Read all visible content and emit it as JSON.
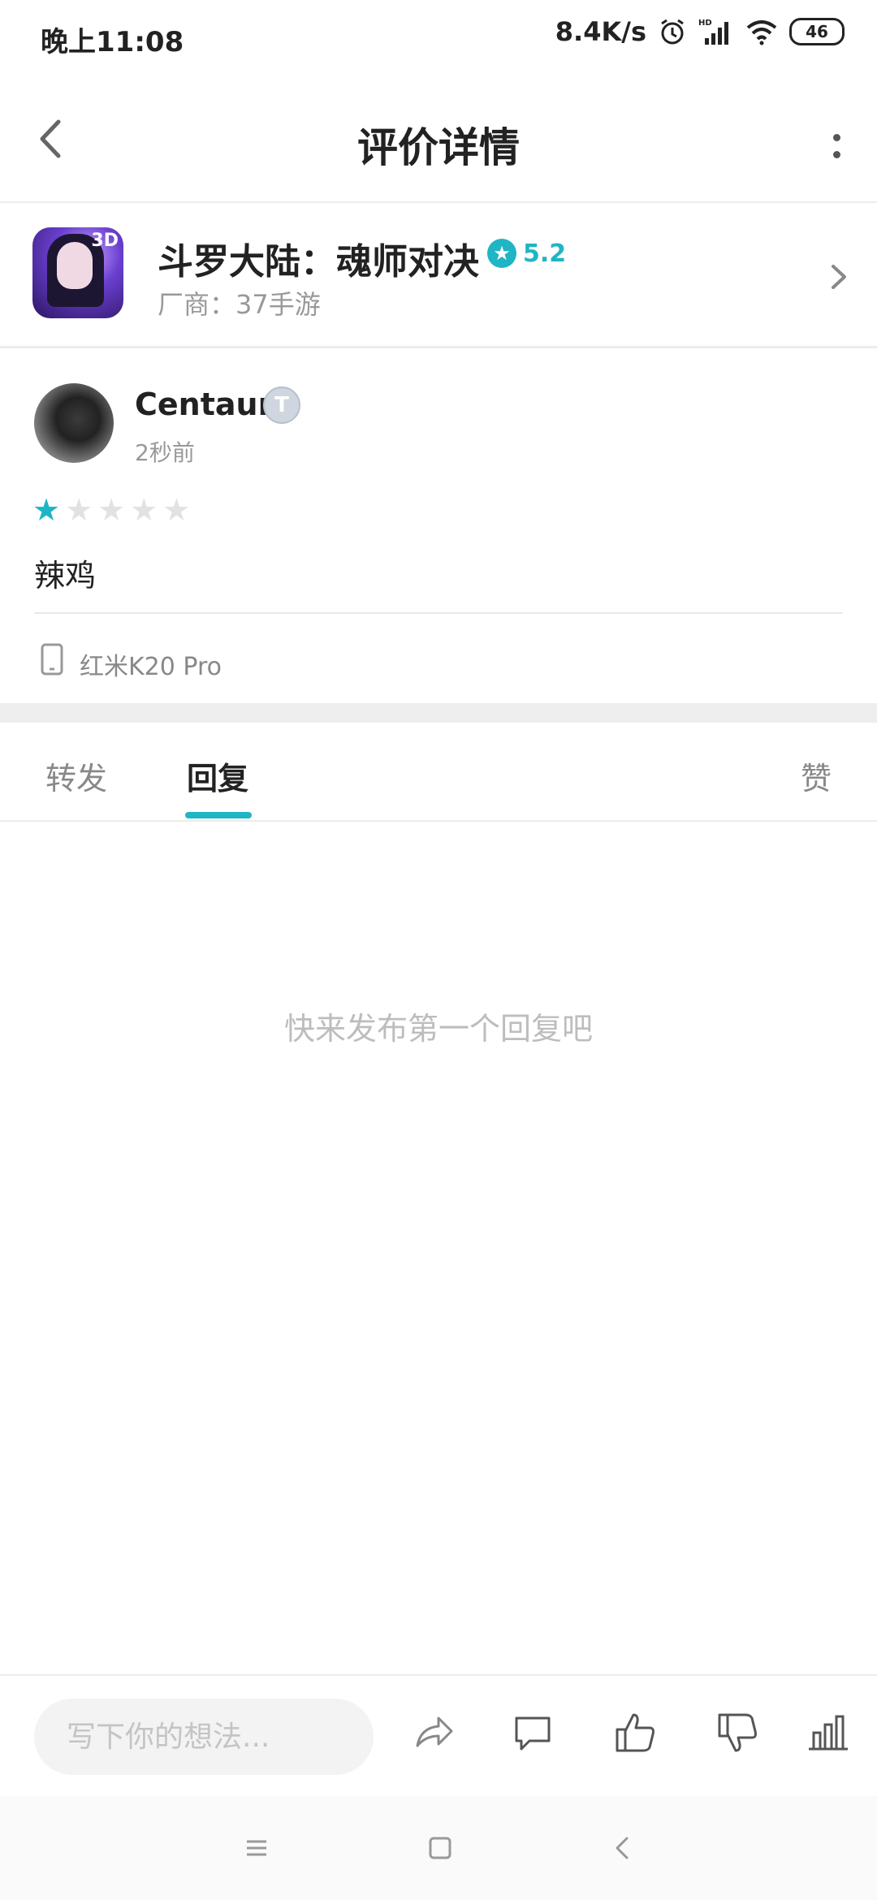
{
  "status_bar": {
    "time": "晚上11:08",
    "network_speed": "8.4K/s",
    "battery": "46",
    "icons": [
      "alarm-icon",
      "hd-signal-icon",
      "wifi-icon",
      "battery-icon"
    ]
  },
  "header": {
    "title": "评价详情",
    "back_icon": "chevron-left-icon",
    "more_icon": "more-vertical-icon"
  },
  "app": {
    "name": "斗罗大陆：魂师对决",
    "rating": "5.2",
    "vendor": "厂商：37手游",
    "icon_badge": "3D"
  },
  "review": {
    "username": "Centaur.",
    "level_badge": "T",
    "time_ago": "2秒前",
    "stars_filled": 1,
    "stars_total": 5,
    "text": "辣鸡",
    "device": "红米K20 Pro"
  },
  "tabs": [
    {
      "label": "转发",
      "active": false
    },
    {
      "label": "回复",
      "active": true
    },
    {
      "label": "赞",
      "active": false
    }
  ],
  "empty_message": "快来发布第一个回复吧",
  "action_bar": {
    "input_placeholder": "写下你的想法..."
  },
  "colors": {
    "accent": "#1fb5c5",
    "text_primary": "#222222",
    "text_secondary": "#999999",
    "divider": "#ececec"
  }
}
